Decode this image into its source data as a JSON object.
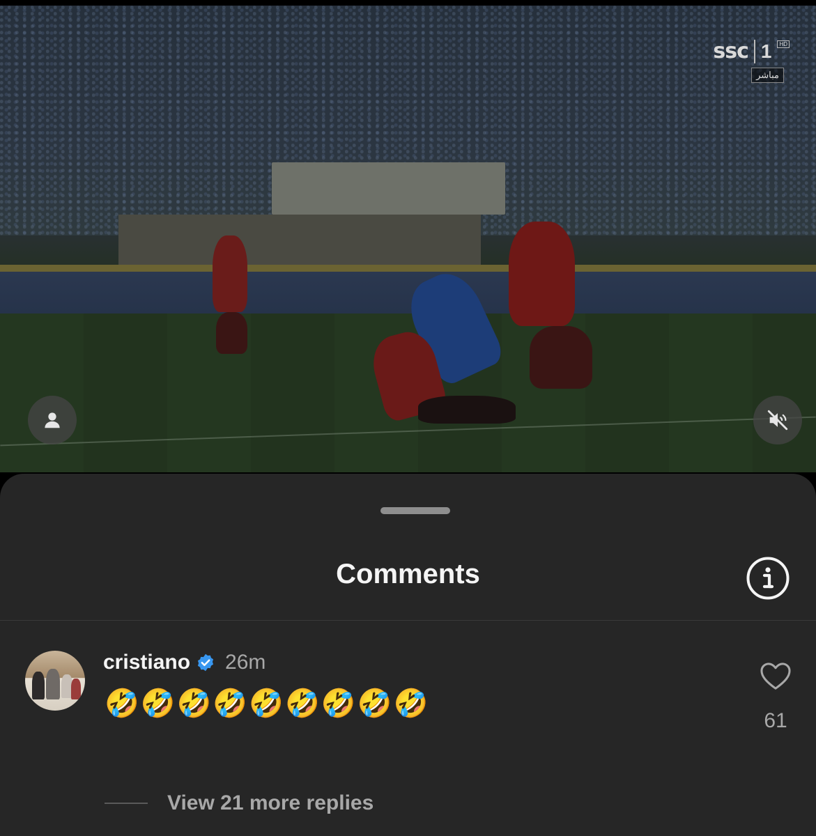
{
  "video": {
    "broadcaster_logo": "ssc",
    "channel_number": "1",
    "hd_badge": "HD",
    "live_badge": "مباشر",
    "profile_button_icon": "person-icon",
    "mute_button_icon": "speaker-muted-icon"
  },
  "sheet": {
    "title": "Comments",
    "info_icon": "info-icon"
  },
  "comment": {
    "username": "cristiano",
    "verified": true,
    "time_ago": "26m",
    "text": "🤣🤣🤣🤣🤣🤣🤣🤣🤣",
    "like_count": "61",
    "view_replies_label": "View 21 more replies"
  },
  "colors": {
    "sheet_background": "#262626",
    "verified_blue": "#3897f0",
    "secondary_text": "#a8a8a8"
  }
}
